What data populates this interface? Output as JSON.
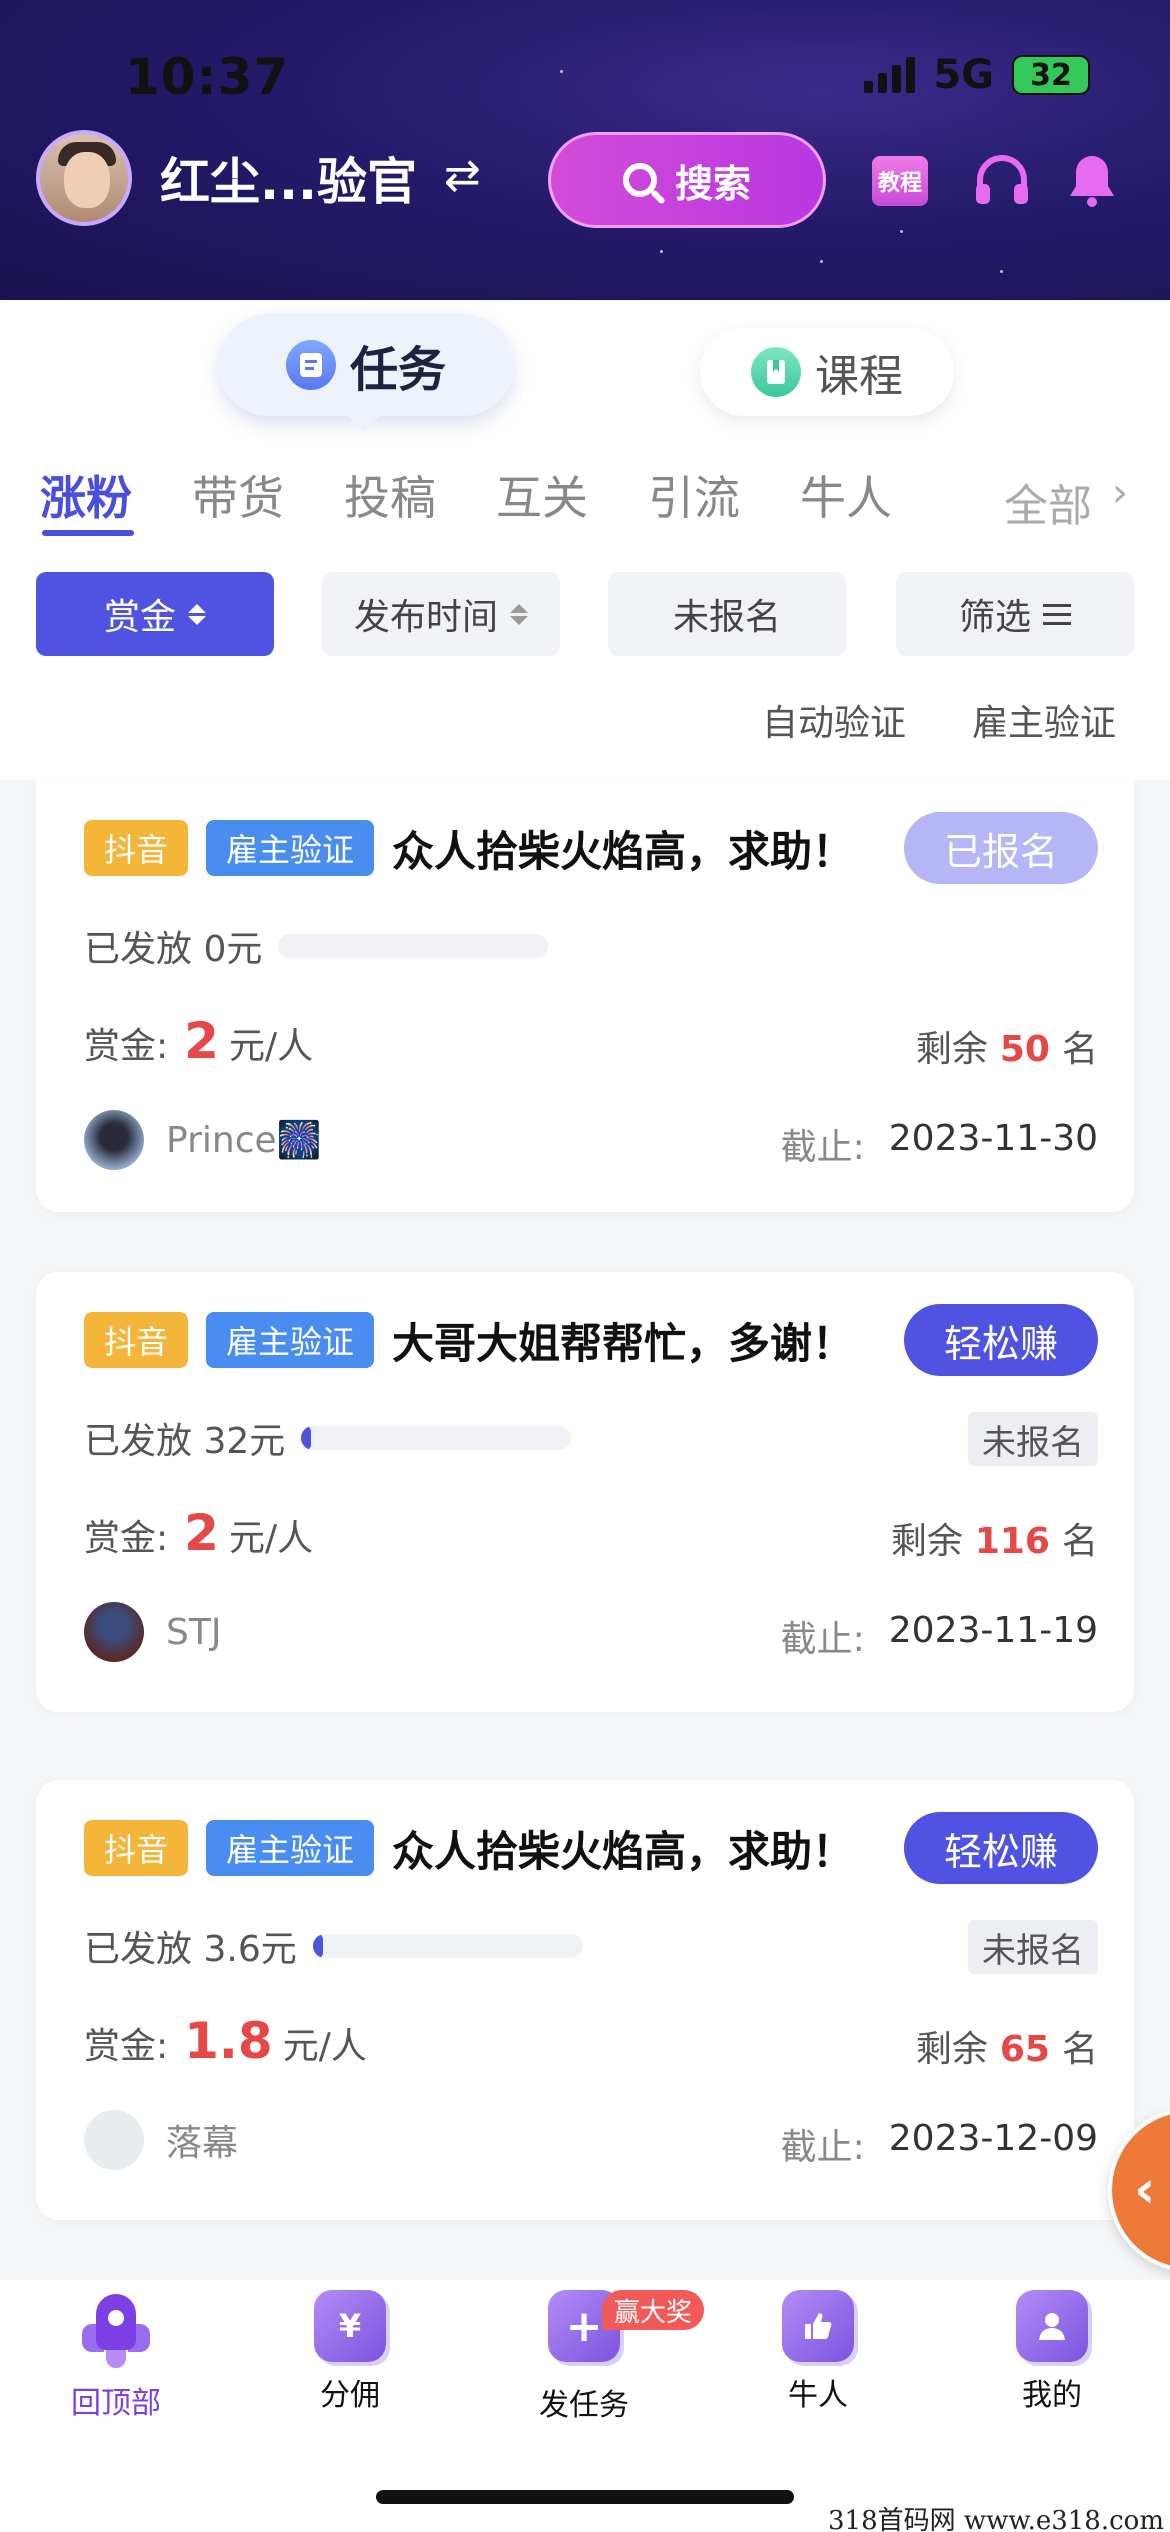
{
  "status_bar": {
    "time": "10:37",
    "network": "5G",
    "battery": "32"
  },
  "header": {
    "username": "红尘...验官",
    "swap_icon": "⇄",
    "search_label": "搜索",
    "tutorial_label": "教程"
  },
  "segments": {
    "task": "任务",
    "course": "课程"
  },
  "categories": [
    "涨粉",
    "带货",
    "投稿",
    "互关",
    "引流",
    "牛人"
  ],
  "category_all": "全部",
  "filters": {
    "reward": "赏金",
    "publish_time": "发布时间",
    "not_enrolled": "未报名",
    "filter": "筛选"
  },
  "verify_links": {
    "auto": "自动验证",
    "employer": "雇主验证"
  },
  "labels": {
    "paid_prefix": "已发放",
    "reward_prefix": "赏金:",
    "reward_unit": "元/人",
    "remain_prefix": "剩余",
    "remain_suffix": "名",
    "deadline_prefix": "截止:",
    "not_enrolled": "未报名"
  },
  "tasks": [
    {
      "platform": "抖音",
      "verify": "雇主验证",
      "title": "众人拾柴火焰高，求助！",
      "action": "已报名",
      "paid": "0元",
      "progress": 0,
      "enrolled": true,
      "reward": "2",
      "remaining": "50",
      "poster": "Prince🎆",
      "deadline": "2023-11-30"
    },
    {
      "platform": "抖音",
      "verify": "雇主验证",
      "title": "大哥大姐帮帮忙，多谢！",
      "action": "轻松赚",
      "paid": "32元",
      "progress": 0.03,
      "enrolled": false,
      "reward": "2",
      "remaining": "116",
      "poster": "STJ",
      "deadline": "2023-11-19"
    },
    {
      "platform": "抖音",
      "verify": "雇主验证",
      "title": "众人拾柴火焰高，求助！",
      "action": "轻松赚",
      "paid": "3.6元",
      "progress": 0.01,
      "enrolled": false,
      "reward": "1.8",
      "remaining": "65",
      "poster": "落幕",
      "deadline": "2023-12-09"
    }
  ],
  "side_tab": "‹",
  "bottom_nav": {
    "top": "回顶部",
    "commission": "分佣",
    "publish": "发任务",
    "prize_badge": "赢大奖",
    "talent": "牛人",
    "mine": "我的"
  },
  "watermark": "318首码网 www.e318.com",
  "colors": {
    "primary": "#5052e2",
    "accent_red": "#e64747",
    "header_bg": "#241a6a",
    "orange": "#ee7a3a"
  }
}
